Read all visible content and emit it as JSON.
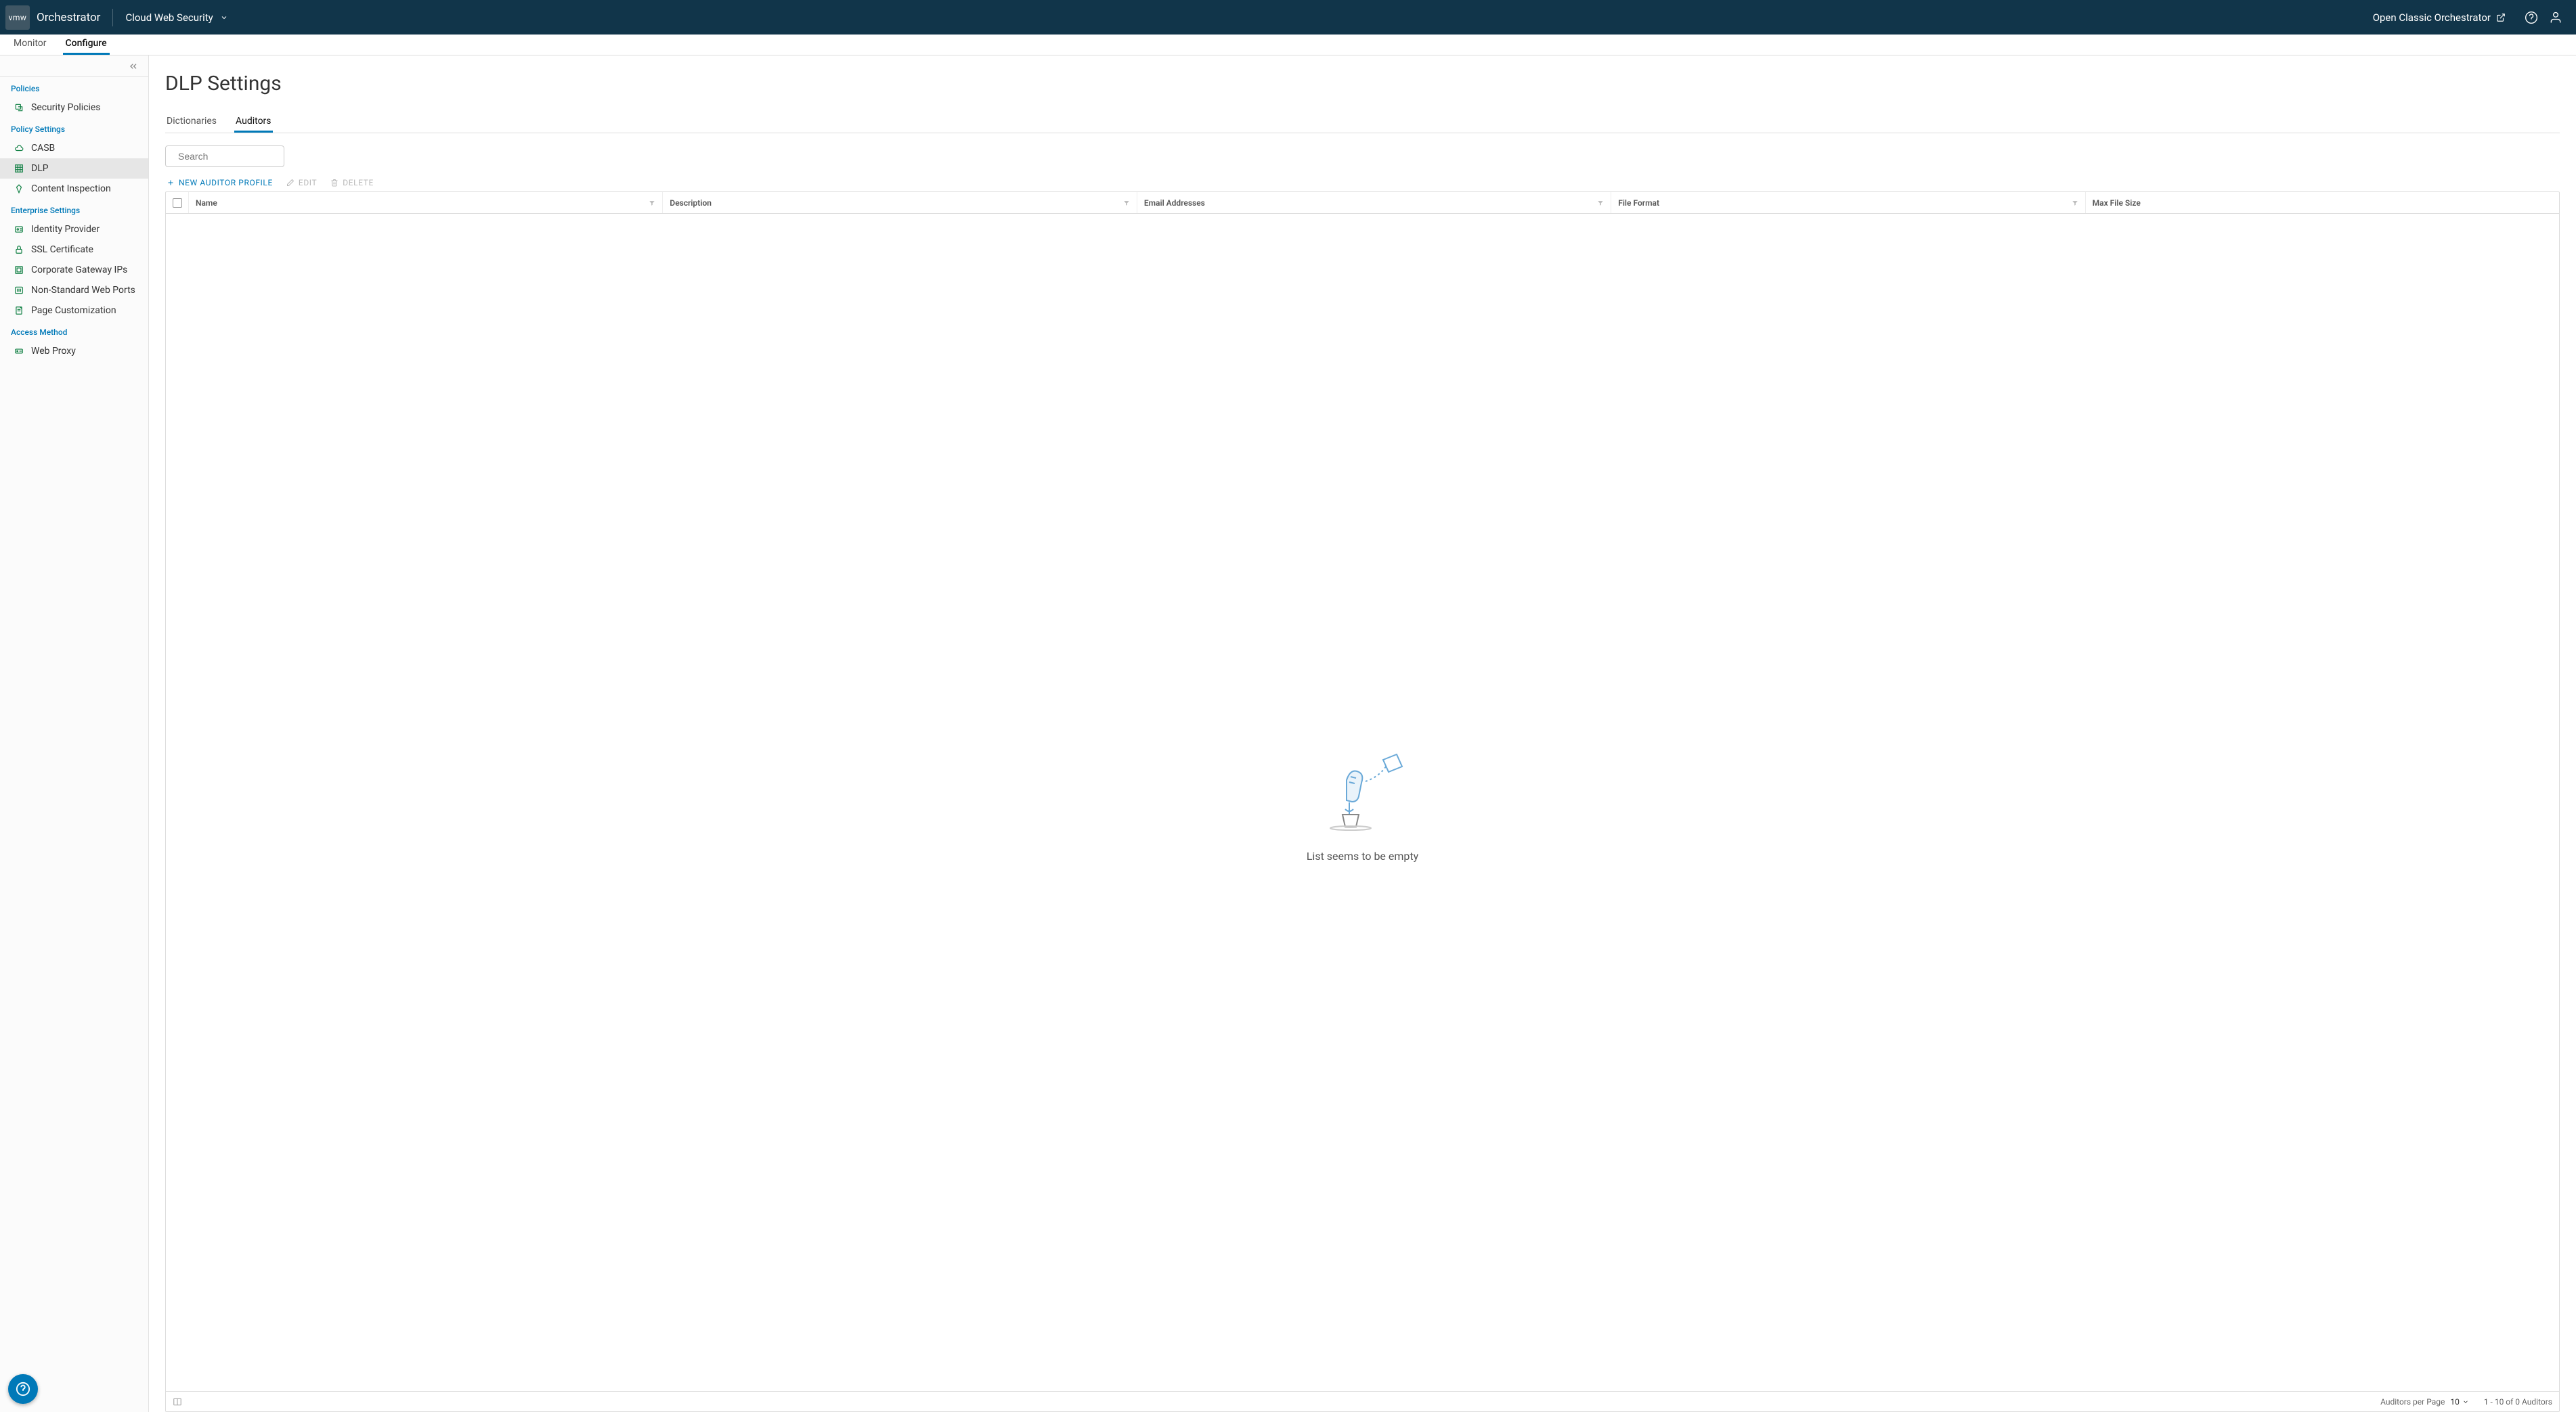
{
  "brand": {
    "chip": "vmw",
    "name": "Orchestrator"
  },
  "service_picker": {
    "label": "Cloud Web Security"
  },
  "classic_link": {
    "label": "Open Classic Orchestrator"
  },
  "primary_tabs": [
    {
      "label": "Monitor",
      "active": false
    },
    {
      "label": "Configure",
      "active": true
    }
  ],
  "sidebar": {
    "sections": [
      {
        "title": "Policies",
        "items": [
          {
            "icon": "shield-out-icon",
            "label": "Security Policies",
            "active": false
          }
        ]
      },
      {
        "title": "Policy Settings",
        "items": [
          {
            "icon": "cloud-icon",
            "label": "CASB",
            "active": false
          },
          {
            "icon": "grid-icon",
            "label": "DLP",
            "active": true
          },
          {
            "icon": "diamond-icon",
            "label": "Content Inspection",
            "active": false
          }
        ]
      },
      {
        "title": "Enterprise Settings",
        "items": [
          {
            "icon": "id-icon",
            "label": "Identity Provider",
            "active": false
          },
          {
            "icon": "lock-icon",
            "label": "SSL Certificate",
            "active": false
          },
          {
            "icon": "router-icon",
            "label": "Corporate Gateway IPs",
            "active": false
          },
          {
            "icon": "ports-icon",
            "label": "Non-Standard Web Ports",
            "active": false
          },
          {
            "icon": "page-icon",
            "label": "Page Customization",
            "active": false
          }
        ]
      },
      {
        "title": "Access Method",
        "items": [
          {
            "icon": "proxy-icon",
            "label": "Web Proxy",
            "active": false
          }
        ]
      }
    ]
  },
  "page": {
    "title": "DLP Settings"
  },
  "sub_tabs": [
    {
      "label": "Dictionaries",
      "active": false
    },
    {
      "label": "Auditors",
      "active": true
    }
  ],
  "search": {
    "placeholder": "Search",
    "value": ""
  },
  "actions": {
    "new": "NEW AUDITOR PROFILE",
    "edit": "EDIT",
    "delete": "DELETE"
  },
  "table": {
    "columns": [
      {
        "label": "Name",
        "filter": true
      },
      {
        "label": "Description",
        "filter": true
      },
      {
        "label": "Email Addresses",
        "filter": true
      },
      {
        "label": "File Format",
        "filter": true
      },
      {
        "label": "Max File Size",
        "filter": false
      }
    ],
    "rows": [],
    "empty_text": "List seems to be empty",
    "footer": {
      "per_page_label": "Auditors per Page",
      "per_page_value": "10",
      "range_text": "1 - 10 of 0 Auditors"
    }
  }
}
